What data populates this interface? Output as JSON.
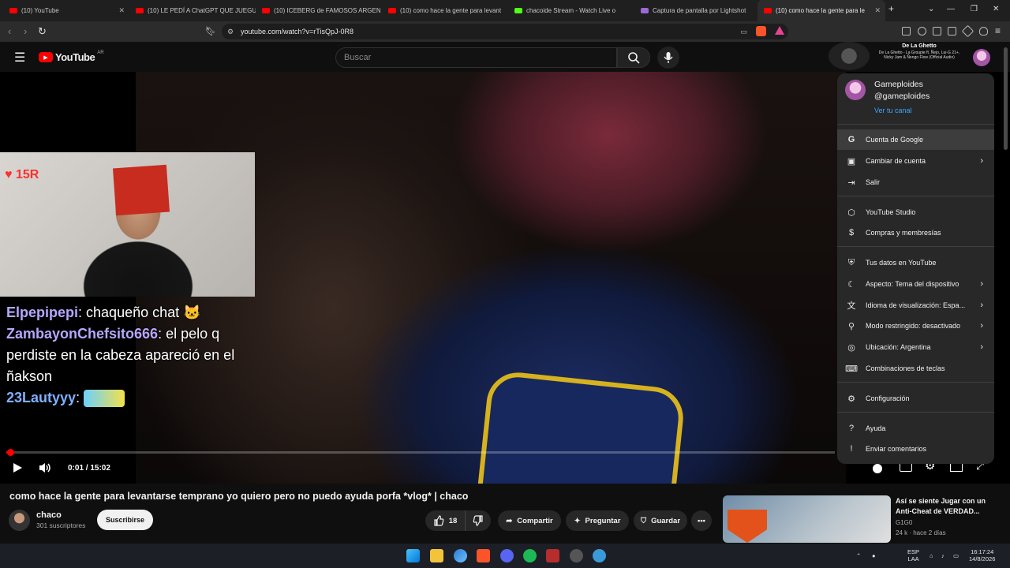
{
  "browser": {
    "tabs": [
      {
        "title": "(10) YouTube"
      },
      {
        "title": "(10) LE PEDÍ A ChatGPT QUE JUEGUE"
      },
      {
        "title": "(10) ICEBERG de FAMOSOS ARGEN"
      },
      {
        "title": "(10) como hace la gente para levant"
      },
      {
        "title": "chacoide Stream - Watch Live o"
      },
      {
        "title": "Captura de pantalla por Lightshot"
      },
      {
        "title": "(10) como hace la gente para le"
      }
    ],
    "new_tab": "+",
    "url": "youtube.com/watch?v=rTisQpJ-0R8"
  },
  "yt_header": {
    "logo": "YouTube",
    "country": "AR",
    "search_placeholder": "Buscar",
    "now_playing_title": "De La Ghetto",
    "now_playing_sub": "De La Ghetto - La Groupie ft. Ñejo, Lui-G 21+, Nicky Jam & Ñengo Flow (Official Audio)"
  },
  "video": {
    "viewers_badge": "15R",
    "chat": [
      {
        "user": "Elpepipepi",
        "msg": "chaqueño chat 🐱"
      },
      {
        "user": "ZambayonChefsito666",
        "msg": "el pelo q perdiste en la cabeza apareció en el ñakson"
      },
      {
        "user": "23Lautyyy",
        "msg": ""
      }
    ],
    "time": "0:01 / 15:02",
    "progress": 0.001
  },
  "watch": {
    "title": "como hace la gente para levantarse temprano yo quiero pero no puedo ayuda porfa *vlog* | chaco",
    "channel": "chaco",
    "subscribers": "301 suscriptores",
    "subscribe": "Suscribirse",
    "likes": "18",
    "share": "Compartir",
    "ask": "Preguntar",
    "save": "Guardar"
  },
  "suggestion": {
    "title": "Así se siente Jugar con un Anti-Cheat de VERDAD...",
    "channel": "G1G0",
    "meta": "24 k · hace 2 días"
  },
  "account_menu": {
    "name": "Gameploides",
    "handle": "@gameploides",
    "channel_link": "Ver tu canal",
    "items": [
      {
        "label": "Cuenta de Google",
        "icon": "google-icon"
      },
      {
        "label": "Cambiar de cuenta",
        "icon": "switch-account-icon"
      },
      {
        "label": "Salir",
        "icon": "sign-out-icon"
      },
      {
        "label": "YouTube Studio",
        "icon": "studio-icon"
      },
      {
        "label": "Compras y membresías",
        "icon": "dollar-icon"
      },
      {
        "label": "Tus datos en YouTube",
        "icon": "shield-person-icon"
      },
      {
        "label": "Aspecto: Tema del dispositivo",
        "icon": "moon-icon"
      },
      {
        "label": "Idioma de visualización: Espa...",
        "icon": "translate-icon"
      },
      {
        "label": "Modo restringido: desactivado",
        "icon": "restricted-icon"
      },
      {
        "label": "Ubicación: Argentina",
        "icon": "globe-icon"
      },
      {
        "label": "Combinaciones de teclas",
        "icon": "keyboard-icon"
      },
      {
        "label": "Configuración",
        "icon": "gear-icon"
      },
      {
        "label": "Ayuda",
        "icon": "help-icon"
      },
      {
        "label": "Enviar comentarios",
        "icon": "feedback-icon"
      }
    ]
  },
  "taskbar": {
    "lang": "ESP",
    "layout": "LAA",
    "time": "16:17:24",
    "date": "14/8/2026"
  }
}
